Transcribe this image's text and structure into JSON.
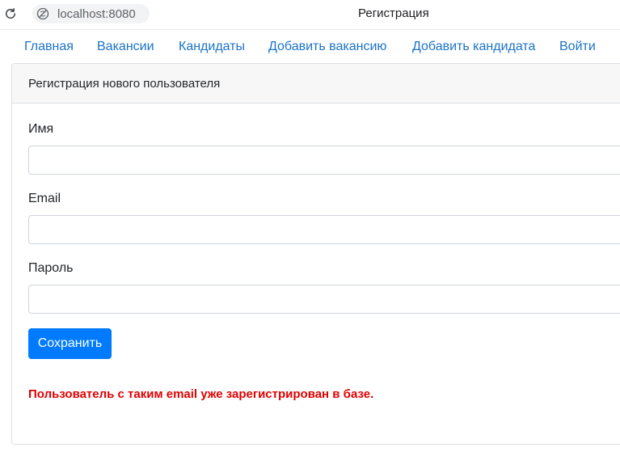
{
  "browser": {
    "url": "localhost:8080",
    "tab_title": "Регистрация"
  },
  "nav": {
    "items": [
      {
        "label": "Главная"
      },
      {
        "label": "Вакансии"
      },
      {
        "label": "Кандидаты"
      },
      {
        "label": "Добавить вакансию"
      },
      {
        "label": "Добавить кандидата"
      },
      {
        "label": "Войти"
      }
    ],
    "link_color": "#1a73c8"
  },
  "form": {
    "title": "Регистрация нового пользователя",
    "name_label": "Имя",
    "name_value": "",
    "email_label": "Email",
    "email_value": "",
    "password_label": "Пароль",
    "password_value": "",
    "save_label": "Сохранить",
    "error_message": "Пользователь с таким email уже зарегистрирован в базе.",
    "button_color": "#007bff",
    "error_color": "#e00000"
  }
}
